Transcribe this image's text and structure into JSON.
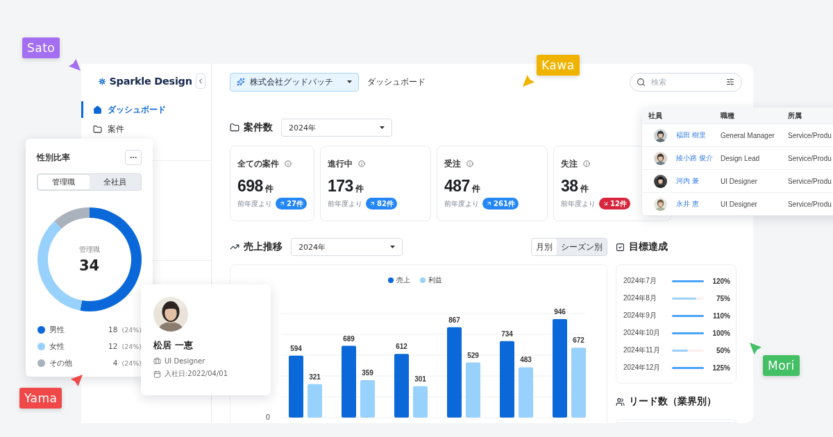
{
  "cursors": [
    {
      "label": "Sato",
      "color": "#a36ef2"
    },
    {
      "label": "Kawa",
      "color": "#f0b400"
    },
    {
      "label": "Mori",
      "color": "#43bf64"
    },
    {
      "label": "Yama",
      "color": "#f04848"
    }
  ],
  "sidebar": {
    "logo": "Sparkle Design",
    "items": [
      {
        "label": "ダッシュボード",
        "selected": true
      },
      {
        "label": "案件",
        "selected": false
      }
    ]
  },
  "header": {
    "company": "株式会社グッドパッチ",
    "breadcrumb": "ダッシュボード",
    "search": {
      "placeholder": "検索"
    }
  },
  "deals": {
    "title": "案件数",
    "period": "2024年",
    "cards": [
      {
        "title": "全ての案件",
        "value": "698",
        "unit": "件",
        "compare": "前年度より",
        "kind": "up",
        "delta": "27件"
      },
      {
        "title": "進行中",
        "value": "173",
        "unit": "件",
        "compare": "前年度より",
        "kind": "up",
        "delta": "82件"
      },
      {
        "title": "受注",
        "value": "487",
        "unit": "件",
        "compare": "前年度より",
        "kind": "up",
        "delta": "261件"
      },
      {
        "title": "失注",
        "value": "38",
        "unit": "件",
        "compare": "前年度より",
        "kind": "down",
        "delta": "12件"
      }
    ]
  },
  "sales": {
    "title": "売上推移",
    "period": "2024年",
    "views": [
      {
        "label": "月別",
        "selected": true
      },
      {
        "label": "シーズン別",
        "selected": false
      }
    ],
    "chart_data": {
      "type": "bar",
      "data_labels": true,
      "annotations": [
        "0"
      ],
      "series": [
        {
          "name": "売上",
          "color": "#0b68d8",
          "values": [
            594,
            689,
            612,
            867,
            734,
            946
          ]
        },
        {
          "name": "利益",
          "color": "#98d1fc",
          "values": [
            321,
            359,
            301,
            529,
            483,
            672
          ]
        }
      ]
    }
  },
  "goals": {
    "title": "目標達成",
    "rows": [
      {
        "month": "2024年7月",
        "level": 1,
        "rate": "120%"
      },
      {
        "month": "2024年8月",
        "level": 0.75,
        "rate": "75%"
      },
      {
        "month": "2024年9月",
        "level": 1,
        "rate": "110%"
      },
      {
        "month": "2024年10月",
        "level": 1,
        "rate": "100%"
      },
      {
        "month": "2024年11月",
        "level": 0.5,
        "rate": "50%"
      },
      {
        "month": "2024年12月",
        "level": 1,
        "rate": "125%"
      }
    ]
  },
  "leads": {
    "title": "リード数（業界別）"
  },
  "gender": {
    "title": "性別比率",
    "tabs": [
      {
        "label": "管理職",
        "selected": true
      },
      {
        "label": "全社員",
        "selected": false
      }
    ],
    "center_label": "管理職",
    "total": "34",
    "chart_data": {
      "type": "donut",
      "values": [
        52.9,
        35.3,
        11.8
      ]
    },
    "legend": [
      {
        "label": "男性",
        "count": "18",
        "share": "(24%)",
        "color": "#0b68d8"
      },
      {
        "label": "女性",
        "count": "12",
        "share": "(24%)",
        "color": "#98d1fc"
      },
      {
        "label": "その他",
        "count": "4",
        "share": "(24%)",
        "color": "#aab2bd"
      }
    ]
  },
  "profile": {
    "name": "松居 一恵",
    "role": "UI Designer",
    "joined": "入社日:2022/04/01"
  },
  "employees": {
    "columns": [
      "社員",
      "職種",
      "所属"
    ],
    "rows": [
      {
        "name": "福田 樹里",
        "role": "General Manager",
        "department": "Service/Produ"
      },
      {
        "name": "綾小路 俊介",
        "role": "Design Lead",
        "department": "Service/Produ"
      },
      {
        "name": "河内 兼",
        "role": "UI Designer",
        "department": "Service/Produ"
      },
      {
        "name": "永井 恵",
        "role": "UI Designer",
        "department": "Service/Produ"
      }
    ]
  }
}
